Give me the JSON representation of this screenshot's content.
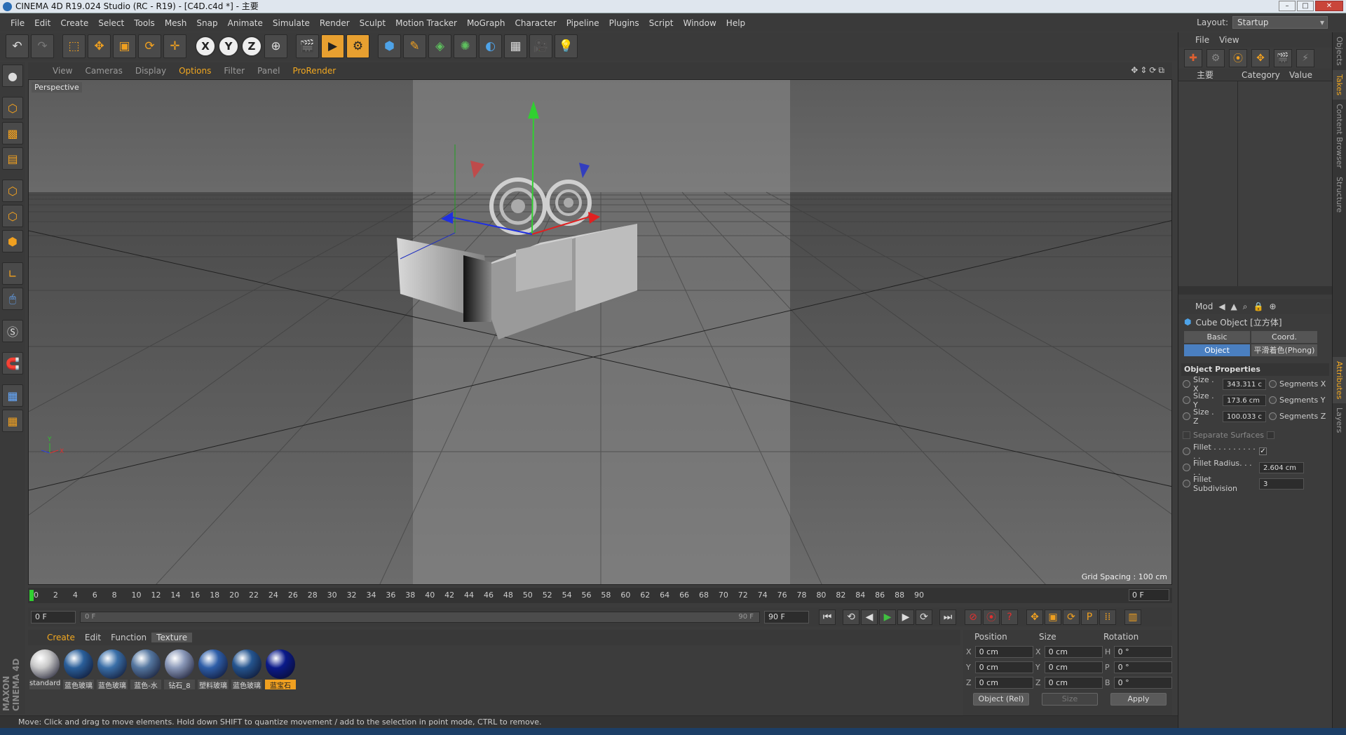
{
  "window": {
    "title": "CINEMA 4D R19.024 Studio (RC - R19) - [C4D.c4d *] - 主要"
  },
  "menu": [
    "File",
    "Edit",
    "Create",
    "Select",
    "Tools",
    "Mesh",
    "Snap",
    "Animate",
    "Simulate",
    "Render",
    "Sculpt",
    "Motion Tracker",
    "MoGraph",
    "Character",
    "Pipeline",
    "Plugins",
    "Script",
    "Window",
    "Help"
  ],
  "layout": {
    "label": "Layout:",
    "value": "Startup"
  },
  "viewport_menu": {
    "items": [
      "View",
      "Cameras",
      "Display",
      "Options",
      "Filter",
      "Panel",
      "ProRender"
    ],
    "label": "Perspective",
    "grid_spacing": "Grid Spacing : 100 cm"
  },
  "timeline": {
    "ticks": [
      "0",
      "2",
      "4",
      "6",
      "8",
      "10",
      "12",
      "14",
      "16",
      "18",
      "20",
      "22",
      "24",
      "26",
      "28",
      "30",
      "32",
      "34",
      "36",
      "38",
      "40",
      "42",
      "44",
      "46",
      "48",
      "50",
      "52",
      "54",
      "56",
      "58",
      "60",
      "62",
      "64",
      "66",
      "68",
      "70",
      "72",
      "74",
      "76",
      "78",
      "80",
      "82",
      "84",
      "86",
      "88",
      "90"
    ],
    "current": "0 F"
  },
  "transport": {
    "start": "0 F",
    "slider_left": "0 F",
    "slider_right": "90 F",
    "end": "90 F"
  },
  "materials": {
    "menu": [
      "Create",
      "Edit",
      "Function",
      "Texture"
    ],
    "items": [
      {
        "label": "standard",
        "color": "#c8c8c8"
      },
      {
        "label": "蓝色玻璃",
        "color": "#2a5f9a"
      },
      {
        "label": "蓝色玻璃",
        "color": "#3a6fa8"
      },
      {
        "label": "蓝色-水",
        "color": "#5577a0"
      },
      {
        "label": "钻石_8",
        "color": "#8a98b8"
      },
      {
        "label": "塑料玻璃",
        "color": "#2e5ea8"
      },
      {
        "label": "蓝色玻璃",
        "color": "#25558f"
      },
      {
        "label": "蓝宝石",
        "color": "#0a1a8a"
      }
    ]
  },
  "coordinates": {
    "headers": [
      "Position",
      "Size",
      "Rotation"
    ],
    "rows": [
      {
        "p_axis": "X",
        "p": "0 cm",
        "s_axis": "X",
        "s": "0 cm",
        "r_axis": "H",
        "r": "0 °"
      },
      {
        "p_axis": "Y",
        "p": "0 cm",
        "s_axis": "Y",
        "s": "0 cm",
        "r_axis": "P",
        "r": "0 °"
      },
      {
        "p_axis": "Z",
        "p": "0 cm",
        "s_axis": "Z",
        "s": "0 cm",
        "r_axis": "B",
        "r": "0 °"
      }
    ],
    "mode": "Object (Rel)",
    "size_mode": "Size",
    "apply": "Apply"
  },
  "status": "Move: Click and drag to move elements. Hold down SHIFT to quantize movement / add to the selection in point mode, CTRL to remove.",
  "object_manager": {
    "menu": [
      "File",
      "View"
    ],
    "col_take": "主要",
    "col_category": "Category",
    "col_value": "Value"
  },
  "attributes": {
    "menu": "Mod",
    "title": "Cube Object [立方体]",
    "tabs": [
      "Basic",
      "Coord.",
      "Object",
      "平滑着色(Phong)"
    ],
    "section": "Object Properties",
    "size_x_label": "Size . X",
    "size_x": "343.311 c",
    "size_y_label": "Size . Y",
    "size_y": "173.6 cm",
    "size_z_label": "Size . Z",
    "size_z": "100.033 c",
    "seg_x": "Segments X",
    "seg_y": "Segments Y",
    "seg_z": "Segments Z",
    "separate": "Separate Surfaces",
    "fillet": "Fillet . . . . . . . . . . .",
    "fillet_radius_label": "Fillet Radius. . . . .",
    "fillet_radius": "2.604 cm",
    "fillet_sub_label": "Fillet Subdivision",
    "fillet_sub": "3"
  },
  "vtabs": [
    "Objects",
    "Takes",
    "Content Browser",
    "Structure",
    "Attributes",
    "Layers"
  ]
}
